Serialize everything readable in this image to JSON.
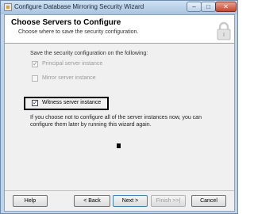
{
  "window": {
    "title": "Configure Database Mirroring Security Wizard",
    "controls": {
      "minimize": "–",
      "maximize": "□",
      "close": "✕"
    }
  },
  "header": {
    "title": "Choose Servers to Configure",
    "subtitle": "Choose where to save the security configuration.",
    "icon": "lock-icon"
  },
  "main": {
    "section_label": "Save the security configuration on the following:",
    "options": [
      {
        "label": "Principal server instance",
        "checked": true,
        "enabled": false
      },
      {
        "label": "Mirror server instance",
        "checked": false,
        "enabled": false
      },
      {
        "label": "Witness server instance",
        "checked": true,
        "enabled": true
      }
    ],
    "hint": "If you choose not to configure all of the server instances now, you can configure them later by running this wizard again."
  },
  "footer": {
    "help": "Help",
    "back": "< Back",
    "next": "Next >",
    "finish": "Finish >>|",
    "cancel": "Cancel"
  }
}
